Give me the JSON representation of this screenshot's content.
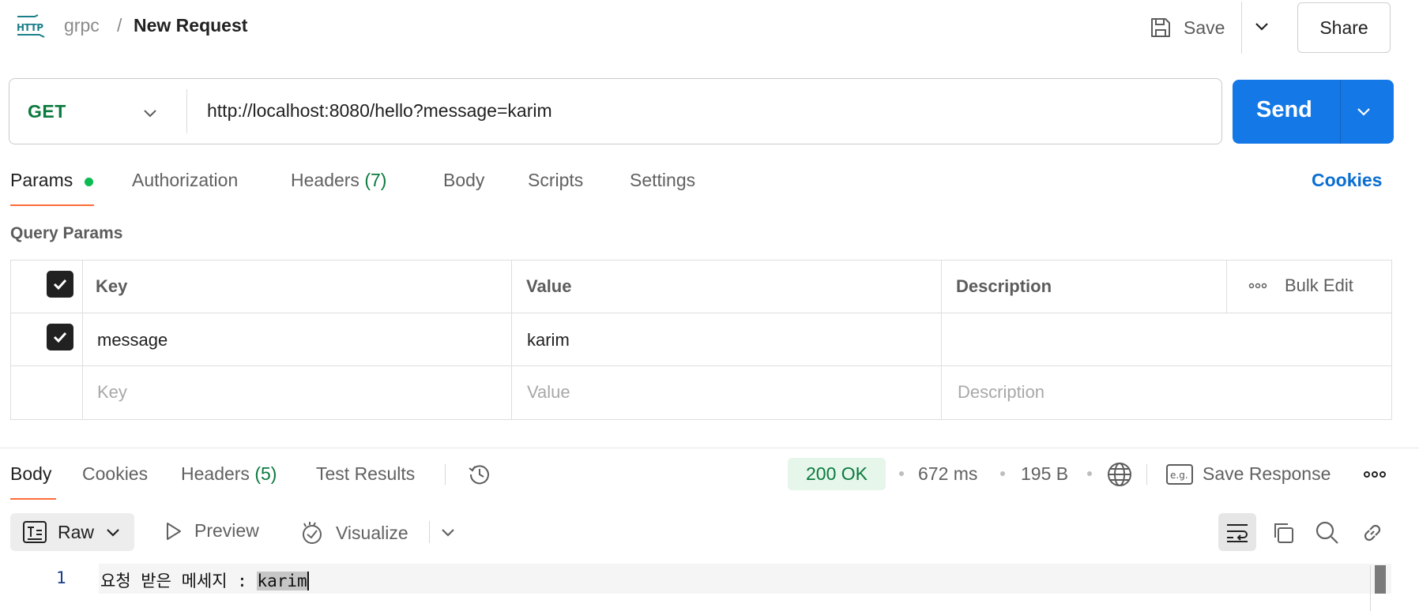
{
  "header": {
    "protocol_icon": "http-icon",
    "collection": "grpc",
    "separator": "/",
    "title": "New Request",
    "save_label": "Save",
    "share_label": "Share"
  },
  "request": {
    "method": "GET",
    "url": "http://localhost:8080/hello?message=karim",
    "send_label": "Send"
  },
  "tabs": {
    "params": "Params",
    "authorization": "Authorization",
    "headers": "Headers",
    "headers_count": "(7)",
    "body": "Body",
    "scripts": "Scripts",
    "settings": "Settings",
    "cookies": "Cookies"
  },
  "query_params": {
    "title": "Query Params",
    "columns": {
      "key": "Key",
      "value": "Value",
      "description": "Description"
    },
    "bulk_edit": "Bulk Edit",
    "rows": [
      {
        "checked": true,
        "key": "message",
        "value": "karim",
        "description": ""
      }
    ],
    "placeholder": {
      "key": "Key",
      "value": "Value",
      "description": "Description"
    }
  },
  "response": {
    "tabs": {
      "body": "Body",
      "cookies": "Cookies",
      "headers": "Headers",
      "headers_count": "(5)",
      "test_results": "Test Results"
    },
    "status": "200 OK",
    "time": "672 ms",
    "size": "195 B",
    "save_response": "Save Response",
    "format": "Raw",
    "preview": "Preview",
    "visualize": "Visualize",
    "line_number": "1",
    "body_prefix": "요청 받은 메세지 : ",
    "body_value": "karim"
  },
  "colors": {
    "send_blue": "#1479e6",
    "method_green": "#0b7a3e",
    "active_tab_underline": "#ff6c37",
    "cookies_link": "#0a6ed1"
  }
}
